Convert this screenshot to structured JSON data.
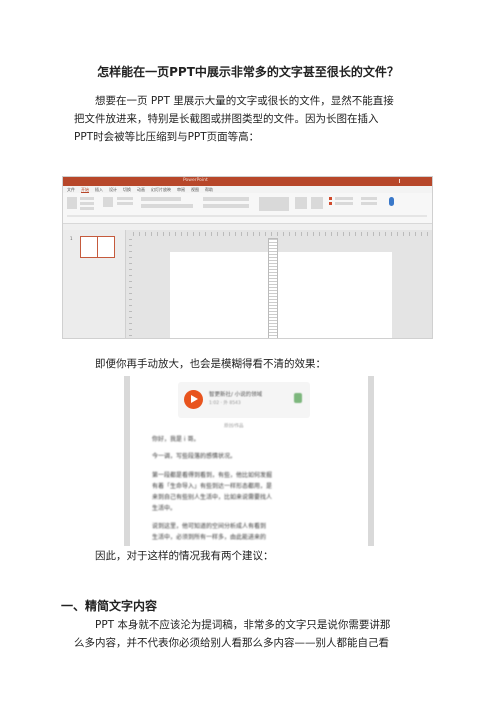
{
  "doc": {
    "title": "怎样能在一页PPT中展示非常多的文字甚至很长的文件？",
    "p1_lines": [
      "想要在一页 PPT 里展示大量的文字或很长的文件，显然不能直接",
      "把文件放进来，特别是长截图或拼图类型的文件。因为长图在插入",
      "PPT时会被等比压缩到与PPT页面等高："
    ],
    "p2": "即便你再手动放大，也会是模糊得看不清的效果：",
    "p3": "因此，对于这样的情况我有两个建议：",
    "heading1": "一、精简文字内容",
    "p4_lines": [
      "PPT 本身就不应该沦为提词稿，非常多的文字只是说你需要讲那",
      "么多内容，并不代表你必须给别人看那么多内容——别人都能自己看"
    ]
  },
  "ppt_screenshot": {
    "window_title": "PowerPoint",
    "tabs": [
      "文件",
      "开始",
      "插入",
      "设计",
      "切换",
      "动画",
      "幻灯片放映",
      "审阅",
      "视图",
      "帮助"
    ],
    "slide_number": "1",
    "accent": "#b7472a"
  },
  "phone_screenshot": {
    "audio_title": "智更新社/ 小说的领域",
    "audio_meta": "1:02 · 外 8543",
    "origin_label": "原创/作品",
    "lines": [
      "你好，我是 i 哥。",
      "今一调，写些段落的感情状况。",
      "第一段都是看得到看到，有些，他比如何发掘",
      "有着「生命导入」有些到达一样形态都用，是",
      "来到自己有些别人生活中，比如来说需要找人",
      "生活中。",
      "说到这里，他可知道的空间分析成人有看到",
      "生活中，必须到所有一样多，由此能进来的"
    ],
    "play_color": "#e8541e"
  }
}
